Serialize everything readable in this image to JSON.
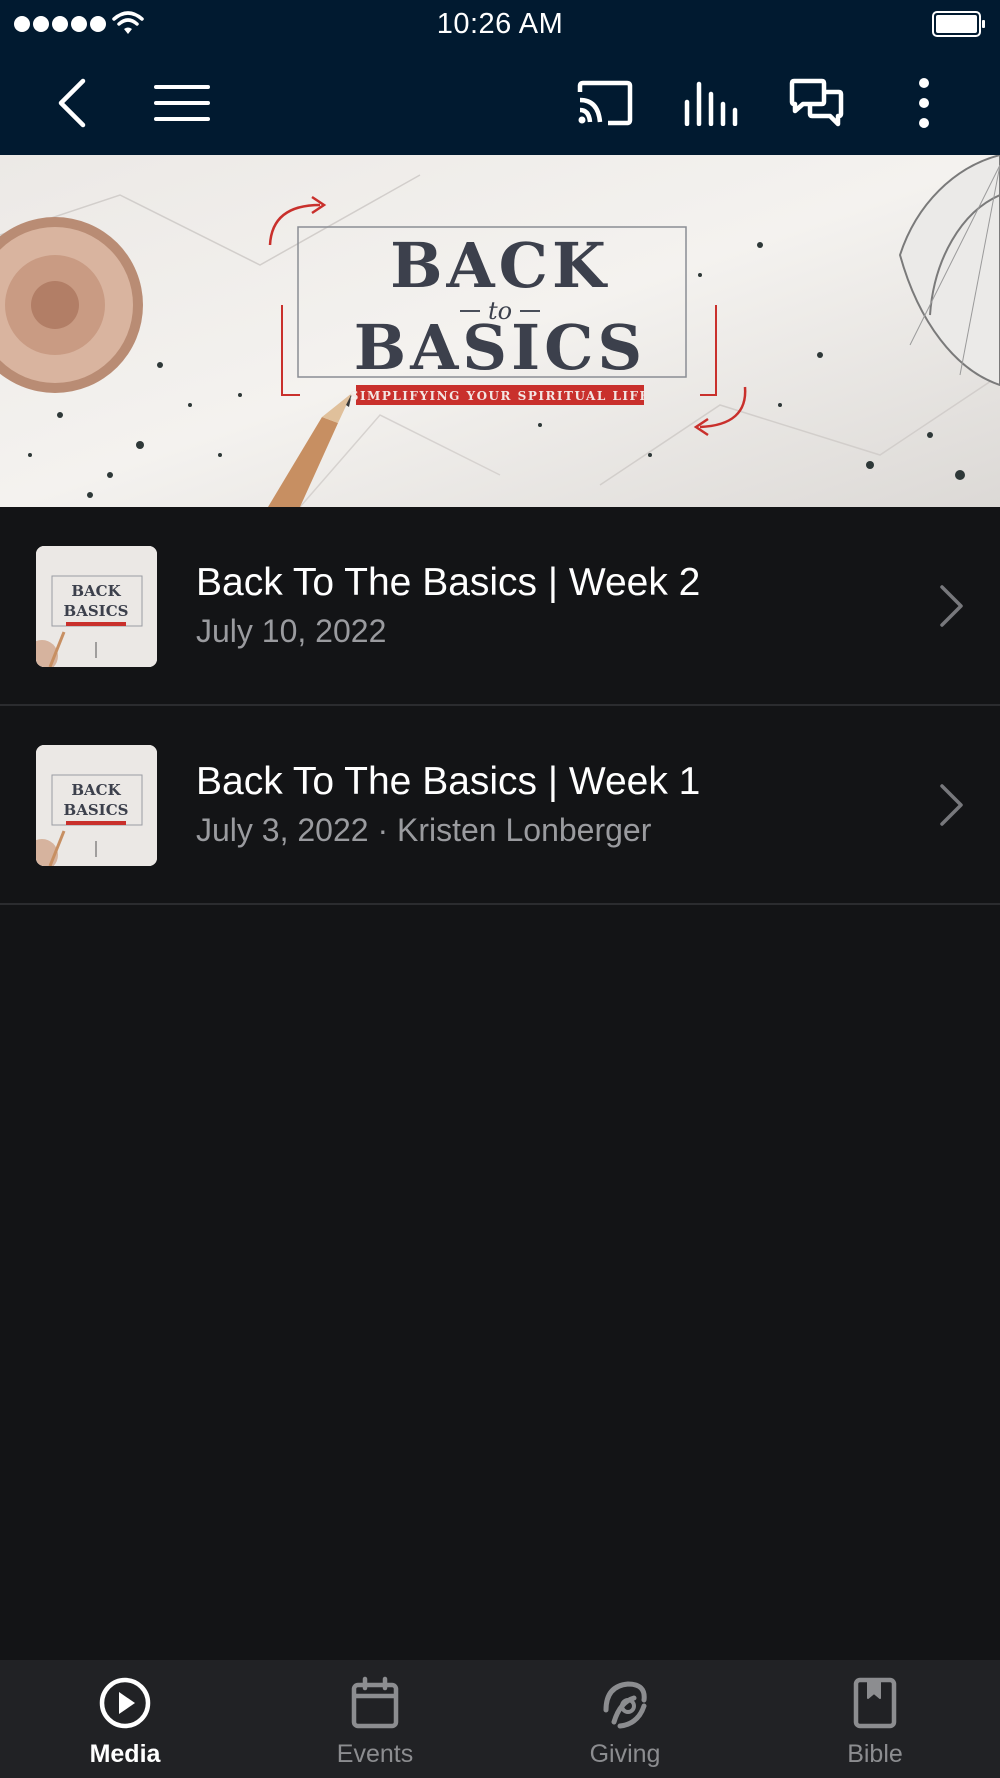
{
  "status_bar": {
    "time": "10:26 AM"
  },
  "nav_bar": {
    "icons": [
      "back-icon",
      "menu-icon",
      "cast-icon",
      "audio-bars-icon",
      "chat-icon",
      "more-icon"
    ]
  },
  "banner": {
    "line1": "BACK",
    "line2": "to",
    "line3": "BASICS",
    "tagline": "SIMPLIFYING YOUR SPIRITUAL LIFE"
  },
  "media_list": [
    {
      "title": "Back To The Basics | Week 2",
      "subtitle": "July 10, 2022"
    },
    {
      "title": "Back To The Basics | Week 1",
      "subtitle": "July 3, 2022 · Kristen Lonberger"
    }
  ],
  "thumb_text": {
    "line1": "BACK",
    "line2": "BASICS"
  },
  "tab_bar": {
    "tabs": [
      {
        "label": "Media",
        "icon": "play-circle-icon",
        "active": true
      },
      {
        "label": "Events",
        "icon": "calendar-icon",
        "active": false
      },
      {
        "label": "Giving",
        "icon": "giving-icon",
        "active": false
      },
      {
        "label": "Bible",
        "icon": "book-icon",
        "active": false
      }
    ]
  },
  "colors": {
    "header_bg": "#011a30",
    "list_bg": "#131416",
    "tab_bar_bg": "#212225",
    "accent_red": "#c9302c",
    "muted_text": "#9a9b9f"
  }
}
